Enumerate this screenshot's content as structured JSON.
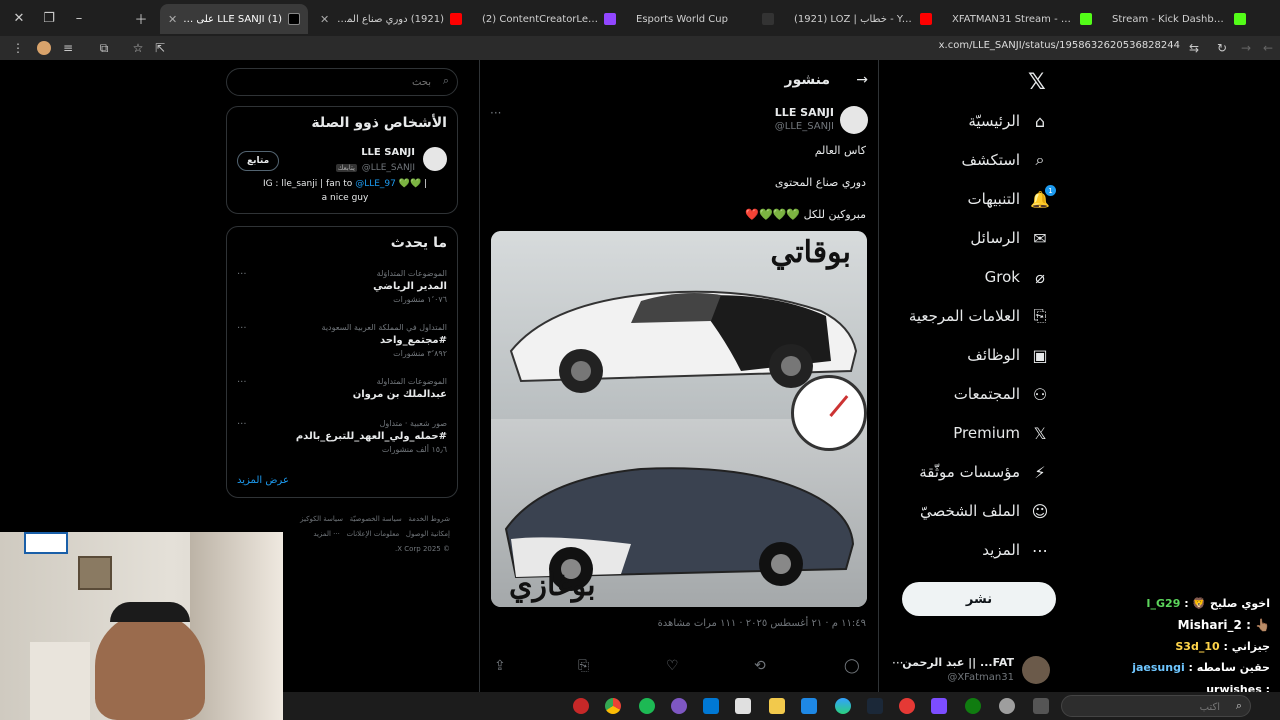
{
  "browser": {
    "tabs": [
      {
        "title": "(1) LLE SANJI على X: \"مبروكين للكل",
        "active": true,
        "color": "#ffffff"
      },
      {
        "title": "(1921) دوري صناع المحتوى - الأس",
        "active": false,
        "color": "#ff0000"
      },
      {
        "title": "(2) ContentCreatorLeague - Tw",
        "active": false,
        "color": "#9146ff"
      },
      {
        "title": "Esports World Cup",
        "active": false,
        "color": "#222222"
      },
      {
        "title": "(1921) LOZ | خطاب - YouTube",
        "active": false,
        "color": "#ff0000"
      },
      {
        "title": "XFATMAN31 Stream - Watch L",
        "active": false,
        "color": "#ff0000"
      },
      {
        "title": "Stream - Kick Dashboard",
        "active": false,
        "color": "#53fc18"
      }
    ],
    "url": "x.com/LLE_SANJI/status/1958632620536828244"
  },
  "nav": {
    "items": [
      {
        "label": "الرئيسيّة",
        "icon": "⌂"
      },
      {
        "label": "استكشف",
        "icon": "⌕"
      },
      {
        "label": "التنبيهات",
        "icon": "🔔"
      },
      {
        "label": "الرسائل",
        "icon": "✉"
      },
      {
        "label": "Grok",
        "icon": "⌀"
      },
      {
        "label": "العلامات المرجعية",
        "icon": "⎘"
      },
      {
        "label": "الوظائف",
        "icon": "▣"
      },
      {
        "label": "المجتمعات",
        "icon": "⚇"
      },
      {
        "label": "Premium",
        "icon": "𝕏"
      },
      {
        "label": "مؤسسات موثّقة",
        "icon": "⚡"
      },
      {
        "label": "الملف الشخصيّ",
        "icon": "☺"
      },
      {
        "label": "المزيد",
        "icon": "⋯"
      }
    ],
    "notification_badge": "1",
    "post_button": "نشر",
    "account": {
      "name": "FAT... || عبد الرحمن",
      "handle": "@XFatman31"
    }
  },
  "post": {
    "header_title": "منشور",
    "author_name": "LLE SANJI",
    "author_handle": "@LLE_SANJI",
    "lines": [
      "كاس العالم",
      "دوري صناع المحتوى",
      "مبروكين للكل 💚💚💚❤️"
    ],
    "image_top_text": "بوقاتي",
    "image_bottom_text": "بوغازي",
    "meta": "١١:٤٩ م · ٢١ أغسطس ٢٠٢٥ · ١١١ مرات مشاهدة"
  },
  "search": {
    "placeholder": "بحث"
  },
  "related": {
    "title": "الأشخاص ذوو الصلة",
    "name": "LLE SANJI",
    "handle": "@LLE_SANJI",
    "follows_you": "يتابعك",
    "follow_button": "متابع",
    "bio_prefix": "IG : lle_sanji | fan to",
    "bio_link": "@LLE_97",
    "bio_suffix": "💚💚 |",
    "bio_line2": "a nice guy"
  },
  "trends": {
    "title": "ما يحدث",
    "items": [
      {
        "context": "الموضوعات المتداوَلة",
        "name": "المدير الرياضي",
        "count": "١٬٠٧٦ منشورات"
      },
      {
        "context": "المتداول في المملكة العربية السعودية",
        "name": "#مجتمع_واحد",
        "count": "٣٬٨٩٢ منشورات"
      },
      {
        "context": "الموضوعات المتداولة",
        "name": "عبدالملك بن مروان",
        "count": ""
      },
      {
        "context": "صور شعبية · متداول",
        "name": "#حمله_ولي_العهد_للتبرع_بالدم",
        "count": "١٥٫٦ ألف منشورات"
      }
    ],
    "show_more": "عرض المزيد"
  },
  "footer": {
    "links": [
      "شروط الخدمة",
      "سياسة الخصوصيّة",
      "سياسة الكوكيز",
      "إمكانية الوصول",
      "معلومات الإعلانات",
      "··· المزيد"
    ],
    "copyright": "© 2025 X Corp."
  },
  "chat": [
    {
      "user": "I_G29",
      "msg": "اخوي صليح 🦁",
      "color": "#5cd65c"
    },
    {
      "user": "Mishari_2",
      "msg": "👆🏽",
      "color": "#ffffff"
    },
    {
      "user": "S3d_10",
      "msg": "جيزاني",
      "color": "#ffd54a"
    },
    {
      "user": "jaesungi",
      "msg": "حقين سامطه",
      "color": "#6ec6ff"
    },
    {
      "user": "urwishes",
      "msg": "",
      "color": "#ffffff"
    }
  ],
  "taskbar": {
    "search_placeholder": "اكتب"
  }
}
